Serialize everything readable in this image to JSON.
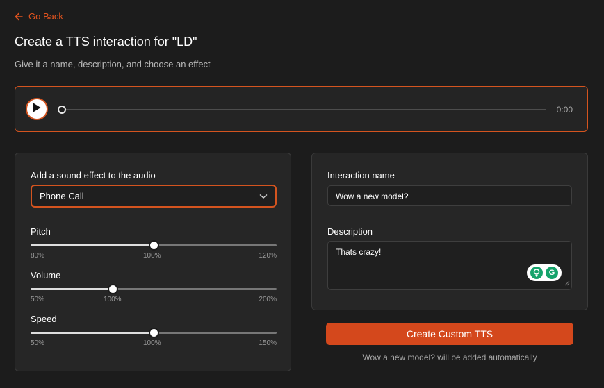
{
  "nav": {
    "go_back_label": "Go Back"
  },
  "header": {
    "title": "Create a TTS interaction for \"LD\"",
    "subtitle": "Give it a name, description, and choose an effect"
  },
  "player": {
    "time": "0:00",
    "progress": 0
  },
  "effects": {
    "label": "Add a sound effect to the audio",
    "selected": "Phone Call",
    "pitch": {
      "label": "Pitch",
      "value_fraction": 0.5,
      "ticks": [
        "80%",
        "100%",
        "120%"
      ]
    },
    "volume": {
      "label": "Volume",
      "value_fraction": 0.333,
      "ticks": [
        "50%",
        "100%",
        "200%"
      ]
    },
    "speed": {
      "label": "Speed",
      "value_fraction": 0.5,
      "ticks": [
        "50%",
        "100%",
        "150%"
      ]
    }
  },
  "form": {
    "name_label": "Interaction name",
    "name_value": "Wow a new model?",
    "description_label": "Description",
    "description_value": "Thats crazy!"
  },
  "actions": {
    "create_label": "Create Custom TTS",
    "note": "Wow a new model? will be added automatically"
  },
  "colors": {
    "accent": "#d4481c",
    "background": "#1c1c1c",
    "panel": "#262626"
  }
}
